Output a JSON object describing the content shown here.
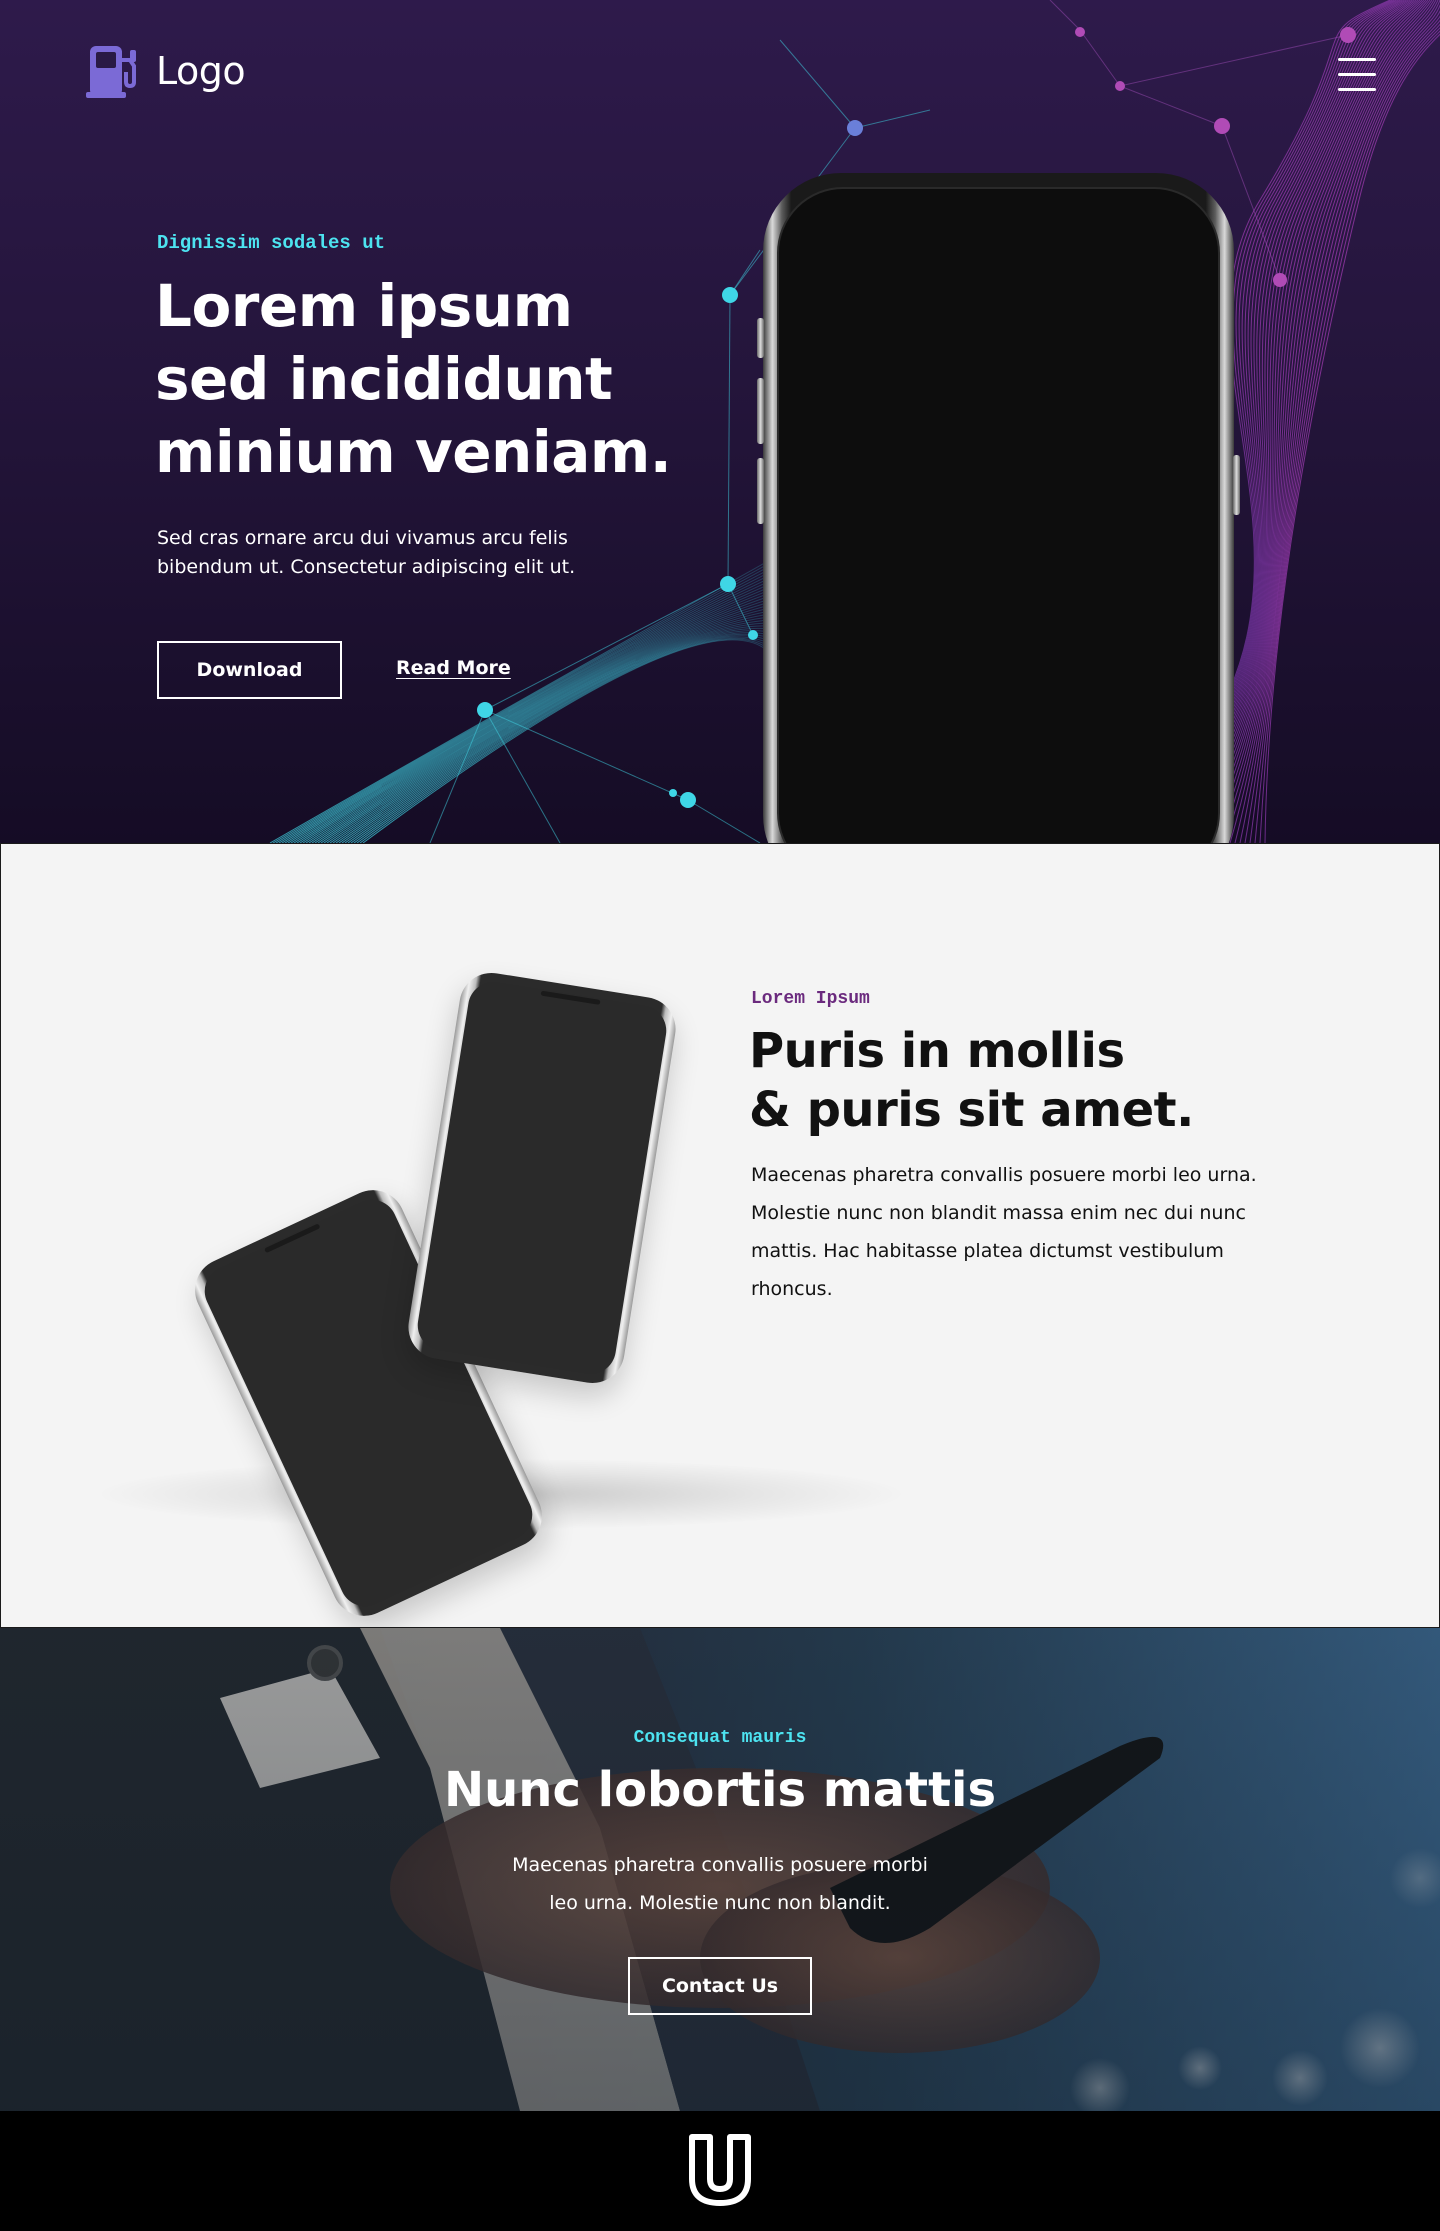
{
  "header": {
    "logo_text": "Logo",
    "logo_icon": "fuel-pump-icon",
    "menu_icon": "hamburger-menu-icon"
  },
  "hero": {
    "kicker": "Dignissim sodales ut",
    "title_line1": "Lorem ipsum",
    "title_line2": "sed incididunt",
    "title_line3": "minium veniam.",
    "description": "Sed cras ornare arcu dui vivamus arcu felis bibendum ut. Consectetur adipiscing elit ut.",
    "download_label": "Download",
    "readmore_label": "Read More"
  },
  "feature": {
    "kicker": "Lorem Ipsum",
    "title_line1": "Puris in mollis",
    "title_line2": "& puris sit amet.",
    "description": "Maecenas pharetra convallis posuere morbi leo urna. Molestie nunc non blandit massa enim nec dui nunc mattis. Hac habitasse platea dictumst vestibulum rhoncus."
  },
  "cta": {
    "kicker": "Consequat mauris",
    "title": "Nunc lobortis mattis",
    "description_line1": "Maecenas pharetra convallis posuere morbi",
    "description_line2": "leo urna. Molestie nunc non blandit.",
    "contact_label": "Contact Us"
  },
  "footer": {
    "logo_icon": "u-shield-logo-icon"
  },
  "colors": {
    "accent_cyan": "#4de3f0",
    "accent_purple": "#6b2a7e",
    "hero_bg": "#24153b",
    "feature_bg": "#f4f4f4",
    "footer_bg": "#000000"
  }
}
